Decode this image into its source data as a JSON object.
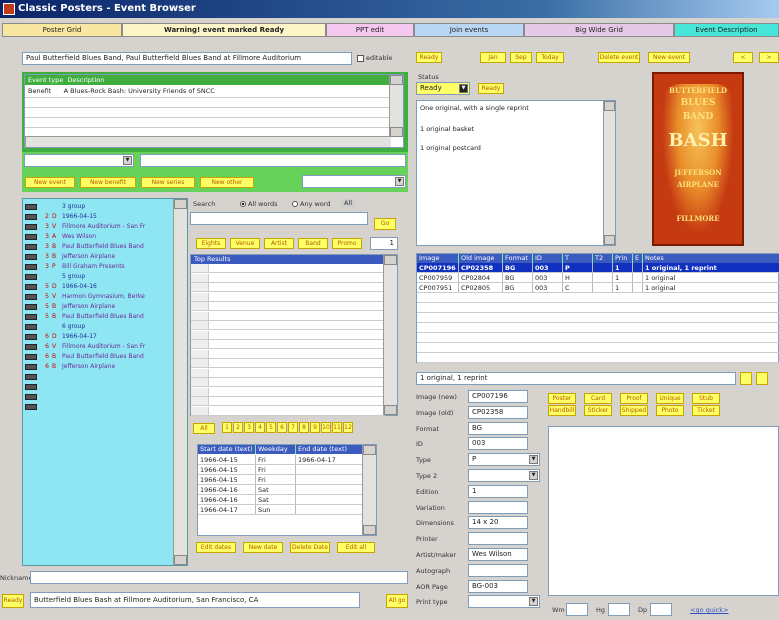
{
  "window": {
    "title": "Classic Posters - Event Browser"
  },
  "tabs": [
    {
      "label": "Poster Grid",
      "color": "#f7e7a0"
    },
    {
      "label": "Warning! event marked Ready",
      "color": "#fbf5c8"
    },
    {
      "label": "PPT edit",
      "color": "#f4c8ef"
    },
    {
      "label": "Join events",
      "color": "#b9d6f2"
    },
    {
      "label": "Big Wide Grid",
      "color": "#e6c9e6"
    },
    {
      "label": "Event Description",
      "color": "#47e6d8"
    }
  ],
  "event_header": {
    "value": "Paul Butterfield Blues Band, Paul Butterfield Blues Band at Fillmore Auditorium",
    "editable_label": "editable"
  },
  "event_types": {
    "headers": [
      "Event type",
      "Description"
    ],
    "rows": [
      {
        "type": "Benefit",
        "desc": "A Blues-Rock Bash: University Friends of SNCC"
      }
    ]
  },
  "type_buttons": [
    "New event",
    "New benefit",
    "New series",
    "New other"
  ],
  "nav_list": [
    {
      "n": "",
      "c": "",
      "t": "3 group",
      "style": "blue"
    },
    {
      "n": "2",
      "c": "D",
      "t": "1966-04-15",
      "style": "blue"
    },
    {
      "n": "3",
      "c": "V",
      "t": "Fillmore Auditorium - San Fr",
      "style": "purple"
    },
    {
      "n": "3",
      "c": "A",
      "t": "Wes Wilson",
      "style": "purple"
    },
    {
      "n": "3",
      "c": "B",
      "t": "Paul Butterfield Blues Band",
      "style": "purple"
    },
    {
      "n": "3",
      "c": "B",
      "t": "Jefferson Airplane",
      "style": "purple"
    },
    {
      "n": "3",
      "c": "P",
      "t": "Bill Graham Presents",
      "style": "purple"
    },
    {
      "n": "",
      "c": "",
      "t": "5 group",
      "style": "blue"
    },
    {
      "n": "5",
      "c": "D",
      "t": "1966-04-16",
      "style": "blue"
    },
    {
      "n": "5",
      "c": "V",
      "t": "Harmon Gymnasium, Berke",
      "style": "purple"
    },
    {
      "n": "5",
      "c": "B",
      "t": "Jefferson Airplane",
      "style": "purple"
    },
    {
      "n": "5",
      "c": "B",
      "t": "Paul Butterfield Blues Band",
      "style": "purple"
    },
    {
      "n": "",
      "c": "",
      "t": "6 group",
      "style": "blue"
    },
    {
      "n": "6",
      "c": "D",
      "t": "1966-04-17",
      "style": "blue"
    },
    {
      "n": "6",
      "c": "V",
      "t": "Fillmore Auditorium - San Fr",
      "style": "purple"
    },
    {
      "n": "6",
      "c": "B",
      "t": "Paul Butterfield Blues Band",
      "style": "purple"
    },
    {
      "n": "6",
      "c": "B",
      "t": "Jefferson Airplane",
      "style": "purple"
    }
  ],
  "search": {
    "label": "Search",
    "radio_all": "All words",
    "radio_any": "Any word",
    "all_label": "All",
    "go": "Go",
    "filter_buttons": [
      "Eights",
      "Venue",
      "Artist",
      "Band",
      "Promo"
    ],
    "count": "1",
    "results_header": "Top Results"
  },
  "pager": {
    "all": "All",
    "pages": [
      "1",
      "2",
      "3",
      "4",
      "5",
      "6",
      "7",
      "8",
      "9",
      "10",
      "11",
      "12"
    ]
  },
  "dates": {
    "headers": [
      "Start date (text)",
      "Weekday",
      "End date (text)"
    ],
    "rows": [
      [
        "1966-04-15",
        "Fri",
        "1966-04-17"
      ],
      [
        "1966-04-15",
        "Fri",
        ""
      ],
      [
        "1966-04-15",
        "Fri",
        ""
      ],
      [
        "1966-04-16",
        "Sat",
        ""
      ],
      [
        "1966-04-16",
        "Sat",
        ""
      ],
      [
        "1966-04-17",
        "Sun",
        ""
      ]
    ],
    "buttons": [
      "Edit dates",
      "New date",
      "Delete Date",
      "Edit all"
    ]
  },
  "top_buttons": [
    "Ready",
    "Jan",
    "Sep",
    "Today",
    "Delete event",
    "New event",
    "<",
    ">"
  ],
  "status": {
    "label": "Status",
    "value": "Ready",
    "ready_btn": "Ready",
    "notes": [
      "One original, with a single reprint",
      "1 original basket",
      "1 original postcard"
    ]
  },
  "images": {
    "headers": [
      "Image",
      "Old image",
      "Format",
      "ID",
      "T",
      "T2",
      "Prin",
      "E",
      "Notes"
    ],
    "rows": [
      [
        "CP007196",
        "CP02358",
        "BG",
        "003",
        "P",
        "",
        "1",
        "",
        "1 original, 1 reprint"
      ],
      [
        "CP007959",
        "CP02804",
        "BG",
        "003",
        "H",
        "",
        "1",
        "",
        "1 original"
      ],
      [
        "CP007951",
        "CP02805",
        "BG",
        "003",
        "C",
        "",
        "1",
        "",
        "1 original"
      ]
    ],
    "selected_note": "1 original, 1 reprint"
  },
  "detail": {
    "fields": [
      {
        "label": "Image (new)",
        "value": "CP007196"
      },
      {
        "label": "Image (old)",
        "value": "CP02358"
      },
      {
        "label": "Format",
        "value": "BG"
      },
      {
        "label": "ID",
        "value": "003"
      },
      {
        "label": "Type",
        "value": "P"
      },
      {
        "label": "Type 2",
        "value": ""
      },
      {
        "label": "Edition",
        "value": "1"
      },
      {
        "label": "Variation",
        "value": ""
      },
      {
        "label": "Dimensions",
        "value": "14 x 20"
      },
      {
        "label": "Printer",
        "value": ""
      },
      {
        "label": "Artist/maker",
        "value": "Wes Wilson"
      },
      {
        "label": "Autograph",
        "value": ""
      },
      {
        "label": "AOR Page",
        "value": "BG-003"
      },
      {
        "label": "Print type",
        "value": ""
      }
    ],
    "action_buttons": [
      "Poster",
      "Card",
      "Proof",
      "Handbill",
      "Sticker",
      "Unique",
      "Shipped",
      "Photo",
      "Stub",
      "Ticket"
    ],
    "dims": {
      "w_label": "Wm",
      "h_label": "Hg",
      "d_label": "Dp",
      "link": "<go quick>"
    }
  },
  "poster": {
    "words": [
      "BUTTERFIELD",
      "BLUES",
      "BAND",
      "BASH",
      "JEFFERSON",
      "AIRPLANE",
      "FILLMORE"
    ],
    "bg": "#c63a12"
  },
  "footer": {
    "nickname_label": "Nickname",
    "ready": "Ready",
    "venue_text": "Butterfield Blues Bash at Fillmore Auditorium, San Francisco, CA",
    "go": "All go"
  }
}
